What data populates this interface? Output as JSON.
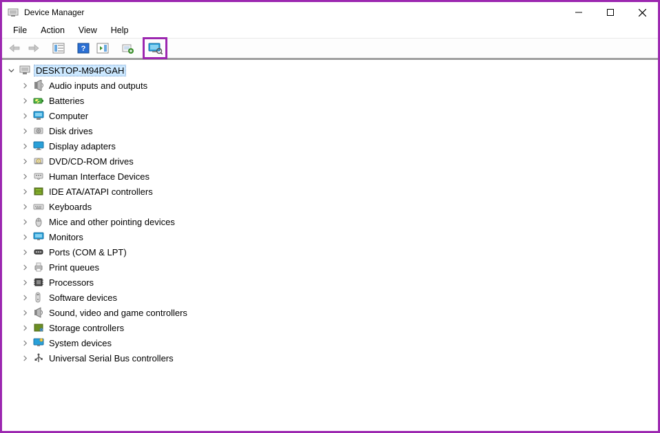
{
  "window": {
    "title": "Device Manager"
  },
  "menu": {
    "file": "File",
    "action": "Action",
    "view": "View",
    "help": "Help"
  },
  "toolbar": {
    "back_icon": "back-arrow-icon",
    "forward_icon": "forward-arrow-icon",
    "show_hide_tree_icon": "show-hide-console-tree-icon",
    "help_icon": "help-icon",
    "action_pane_icon": "show-hide-action-pane-icon",
    "update_driver_icon": "update-driver-icon",
    "show_hidden_icon": "scan-hardware-icon"
  },
  "tree": {
    "root": {
      "label": "DESKTOP-M94PGAH",
      "expanded": true,
      "selected": true
    },
    "categories": [
      {
        "label": "Audio inputs and outputs",
        "icon": "speaker-icon"
      },
      {
        "label": "Batteries",
        "icon": "battery-icon"
      },
      {
        "label": "Computer",
        "icon": "computer-icon"
      },
      {
        "label": "Disk drives",
        "icon": "disk-drive-icon"
      },
      {
        "label": "Display adapters",
        "icon": "display-adapter-icon"
      },
      {
        "label": "DVD/CD-ROM drives",
        "icon": "optical-drive-icon"
      },
      {
        "label": "Human Interface Devices",
        "icon": "hid-icon"
      },
      {
        "label": "IDE ATA/ATAPI controllers",
        "icon": "ide-controller-icon"
      },
      {
        "label": "Keyboards",
        "icon": "keyboard-icon"
      },
      {
        "label": "Mice and other pointing devices",
        "icon": "mouse-icon"
      },
      {
        "label": "Monitors",
        "icon": "monitor-icon"
      },
      {
        "label": "Ports (COM & LPT)",
        "icon": "port-icon"
      },
      {
        "label": "Print queues",
        "icon": "printer-icon"
      },
      {
        "label": "Processors",
        "icon": "processor-icon"
      },
      {
        "label": "Software devices",
        "icon": "software-device-icon"
      },
      {
        "label": "Sound, video and game controllers",
        "icon": "sound-controller-icon"
      },
      {
        "label": "Storage controllers",
        "icon": "storage-controller-icon"
      },
      {
        "label": "System devices",
        "icon": "system-device-icon"
      },
      {
        "label": "Universal Serial Bus controllers",
        "icon": "usb-icon"
      }
    ]
  }
}
